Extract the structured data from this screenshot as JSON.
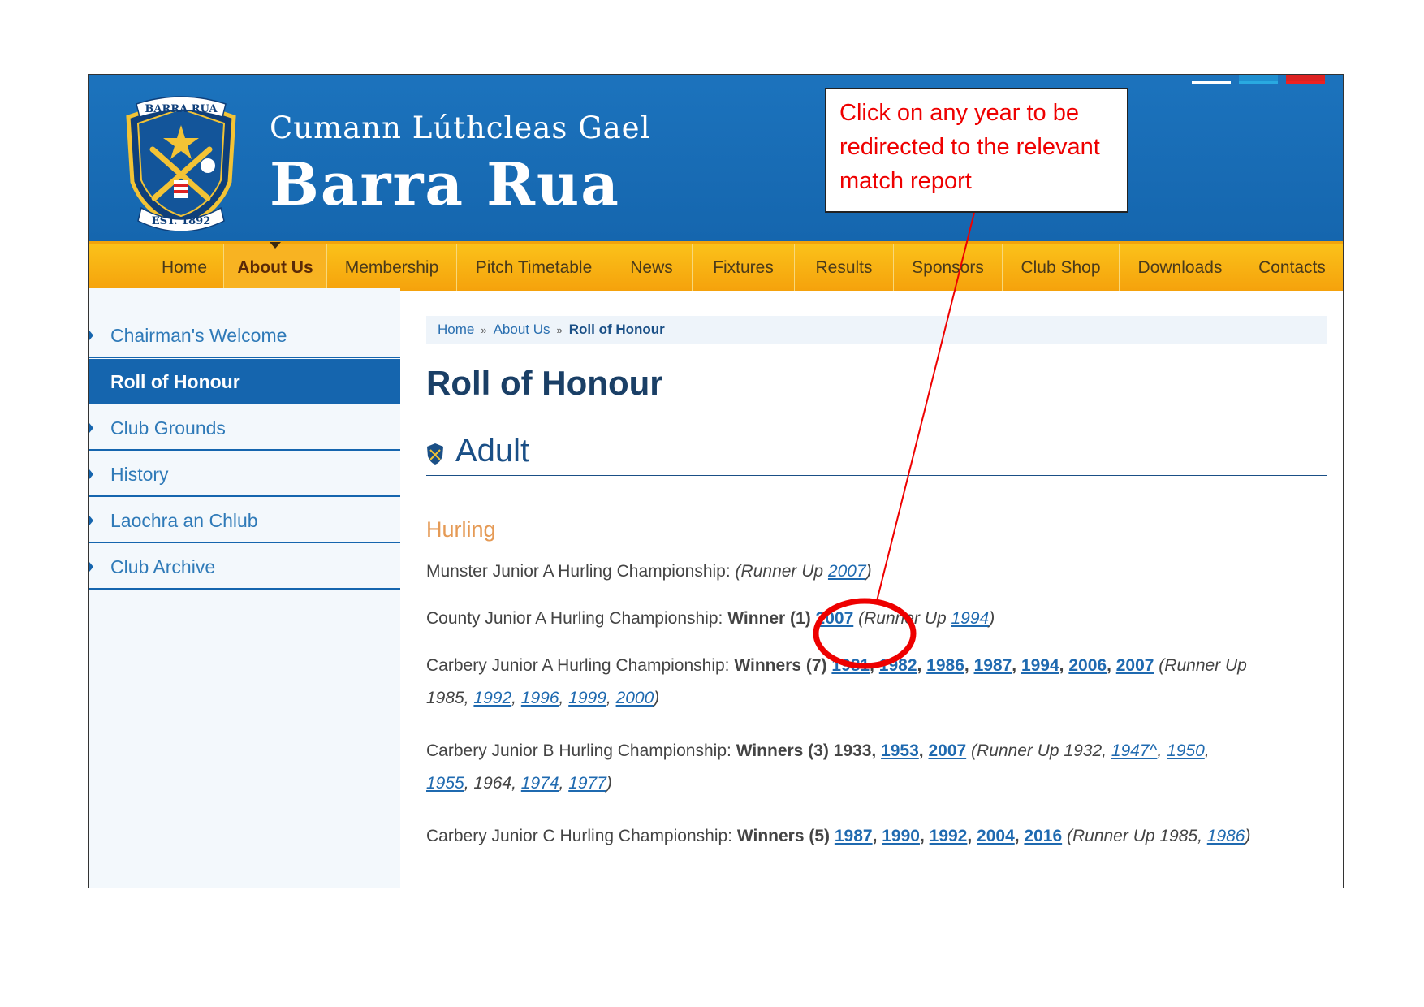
{
  "header": {
    "title_small": "Cumann Lúthcleas Gael",
    "title_big": "Barra Rua",
    "crest_top_text": "BARRA RUA",
    "crest_bottom_text": "EST. 1892"
  },
  "nav": {
    "items": [
      {
        "label": "Home"
      },
      {
        "label": "About Us"
      },
      {
        "label": "Membership"
      },
      {
        "label": "Pitch Timetable"
      },
      {
        "label": "News"
      },
      {
        "label": "Fixtures"
      },
      {
        "label": "Results"
      },
      {
        "label": "Sponsors"
      },
      {
        "label": "Club Shop"
      },
      {
        "label": "Downloads"
      },
      {
        "label": "Contacts"
      }
    ],
    "active": "About Us"
  },
  "sidebar": {
    "items": [
      {
        "label": "Chairman's Welcome"
      },
      {
        "label": "Roll of Honour"
      },
      {
        "label": "Club Grounds"
      },
      {
        "label": "History"
      },
      {
        "label": "Laochra an Chlub"
      },
      {
        "label": "Club Archive"
      }
    ],
    "active": "Roll of Honour"
  },
  "breadcrumb": {
    "home": "Home",
    "about": "About Us",
    "current": "Roll of Honour",
    "separator": "»"
  },
  "page_title": "Roll of Honour",
  "section_title": "Adult",
  "subsection_title": "Hurling",
  "entries": {
    "munster": {
      "label": "Munster Junior A Hurling Championship:",
      "runner_prefix": "(Runner Up ",
      "y1": "2007",
      "runner_suffix": ")"
    },
    "county": {
      "label": "County Junior A Hurling Championship:",
      "winners": "Winner (1)",
      "y1": "2007",
      "runner_prefix": "(Runner Up ",
      "r1": "1994",
      "runner_suffix": ")"
    },
    "carbery_a": {
      "label": "Carbery Junior A Hurling Championship:",
      "winners": "Winners (7)",
      "years": [
        "1981",
        "1982",
        "1986",
        "1987",
        "1994",
        "2006",
        "2007"
      ],
      "runner_prefix": "(Runner Up",
      "runner_plain": "1985,",
      "runner_years": [
        "1992",
        "1996",
        "1999",
        "2000"
      ],
      "runner_suffix": ")"
    },
    "carbery_b": {
      "label": "Carbery Junior B Hurling Championship:",
      "winners": "Winners (3) 1933,",
      "years": [
        "1953",
        "2007"
      ],
      "runner_prefix": "(Runner Up 1932,",
      "runner_years_1": [
        "1947^",
        "1950"
      ],
      "runner_years_2a": "1955",
      "runner_plain_mid": ", 1964,",
      "runner_years_2b": [
        "1974",
        "1977"
      ],
      "runner_suffix": ")"
    },
    "carbery_c": {
      "label": "Carbery Junior C Hurling Championship:",
      "winners": "Winners (5)",
      "years": [
        "1987",
        "1990",
        "1992",
        "2004",
        "2016"
      ],
      "runner_prefix": "(Runner Up 1985,",
      "runner_years": [
        "1986"
      ],
      "runner_suffix": ")"
    }
  },
  "annotation": {
    "callout_text": "Click on any year to be redirected to the relevant match report",
    "color": "#e00000"
  },
  "colors": {
    "header_blue": "#1566ae",
    "nav_orange": "#f7b016",
    "link_blue": "#1f6ab0",
    "accent_orange": "#e59a55"
  }
}
